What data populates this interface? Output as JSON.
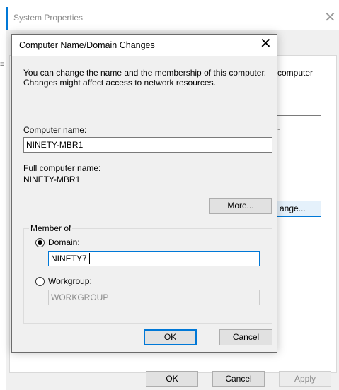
{
  "outer": {
    "title": "System Properties",
    "close_glyph": "✕",
    "desc_tail": "computer",
    "dash": "-",
    "change_button": "ange...",
    "ok": "OK",
    "cancel": "Cancel",
    "apply": "Apply",
    "left_glyph": "≡"
  },
  "dialog": {
    "title": "Computer Name/Domain Changes",
    "close_glyph": "✕",
    "description": "You can change the name and the membership of this computer. Changes might affect access to network resources.",
    "computer_name_label": "Computer name:",
    "computer_name_value": "NINETY-MBR1",
    "full_name_label": "Full computer name:",
    "full_name_value": "NINETY-MBR1",
    "more_button": "More...",
    "member_of_label": "Member of",
    "domain_label": "Domain:",
    "domain_value": "NINETY7",
    "workgroup_label": "Workgroup:",
    "workgroup_value": "WORKGROUP",
    "selected_option": "Domain",
    "ok": "OK",
    "cancel": "Cancel"
  },
  "colors": {
    "accent": "#0078d7",
    "window_bg": "#f0f0f0"
  }
}
